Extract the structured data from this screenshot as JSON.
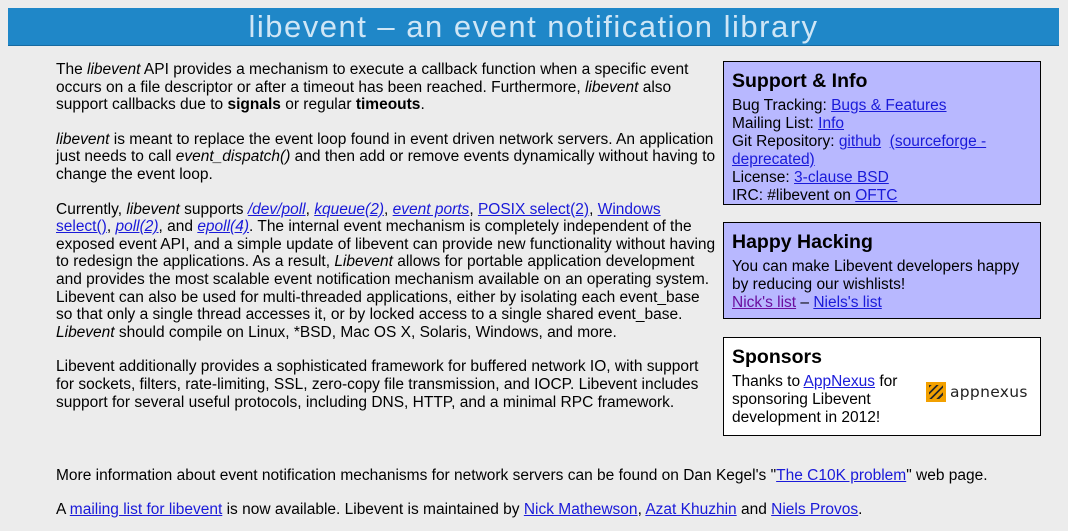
{
  "header": {
    "title": "libevent – an event notification library"
  },
  "intro": {
    "p1_a": "The ",
    "p1_b": "libevent",
    "p1_c": " API provides a mechanism to execute a callback function when a specific event occurs on a file descriptor or after a timeout has been reached. Furthermore, ",
    "p1_d": "libevent",
    "p1_e": " also support callbacks due to ",
    "p1_f": "signals",
    "p1_g": " or regular ",
    "p1_h": "timeouts",
    "p1_i": ".",
    "p2_a": "libevent",
    "p2_b": " is meant to replace the event loop found in event driven network servers. An application just needs to call ",
    "p2_c": "event_dispatch()",
    "p2_d": " and then add or remove events dynamically without having to change the event loop.",
    "p3_a": "Currently, ",
    "p3_b": "libevent",
    "p3_c": " supports ",
    "link_devpoll": "/dev/poll",
    "link_kqueue": "kqueue(2)",
    "link_eventports": "event ports",
    "link_select": "POSIX select(2)",
    "link_winselect": "Windows select()",
    "link_poll": "poll(2)",
    "link_epoll": "epoll(4)",
    "p3_d": ". The internal event mechanism is completely independent of the exposed event API, and a simple update of libevent can provide new functionality without having to redesign the applications. As a result, ",
    "p3_e": "Libevent",
    "p3_f": " allows for portable application development and provides the most scalable event notification mechanism available on an operating system. Libevent can also be used for multi-threaded applications, either by isolating each event_base so that only a single thread accesses it, or by locked access to a single shared event_base. ",
    "p3_g": "Libevent",
    "p3_h": " should compile on Linux, *BSD, Mac OS X, Solaris, Windows, and more.",
    "p4": "Libevent additionally provides a sophisticated framework for buffered network IO, with support for sockets, filters, rate-limiting, SSL, zero-copy file transmission, and IOCP. Libevent includes support for several useful protocols, including DNS, HTTP, and a minimal RPC framework."
  },
  "footer": {
    "c10k_a": "More information about event notification mechanisms for network servers can be found on Dan Kegel's \"",
    "c10k_link": "The C10K problem",
    "c10k_b": "\" web page.",
    "ml_a": "A ",
    "ml_link": "mailing list for libevent",
    "ml_b": " is now available. Libevent is maintained by ",
    "m1": "Nick Mathewson",
    "m2": "Azat Khuzhin",
    "and": " and ",
    "m3": "Niels Provos",
    "end": "."
  },
  "support": {
    "title": "Support & Info",
    "bug_label": "Bug Tracking: ",
    "bug_link": "Bugs & Features",
    "ml_label": "Mailing List: ",
    "ml_link": "Info",
    "git_label": "Git Repository: ",
    "git_link": "github",
    "sf_link": "(sourceforge - deprecated)",
    "lic_label": "License: ",
    "lic_link": "3-clause BSD",
    "irc_label": "IRC: #libevent on ",
    "irc_link": "OFTC"
  },
  "hacking": {
    "title": "Happy Hacking",
    "text": "You can make Libevent developers happy by reducing our wishlists!",
    "nick": "Nick's list",
    "dash": " – ",
    "niels": "Niels's list"
  },
  "sponsors": {
    "title": "Sponsors",
    "a": "Thanks to ",
    "link": "AppNexus",
    "b": " for sponsoring Libevent development in 2012!",
    "logo_text": "appnexus"
  }
}
